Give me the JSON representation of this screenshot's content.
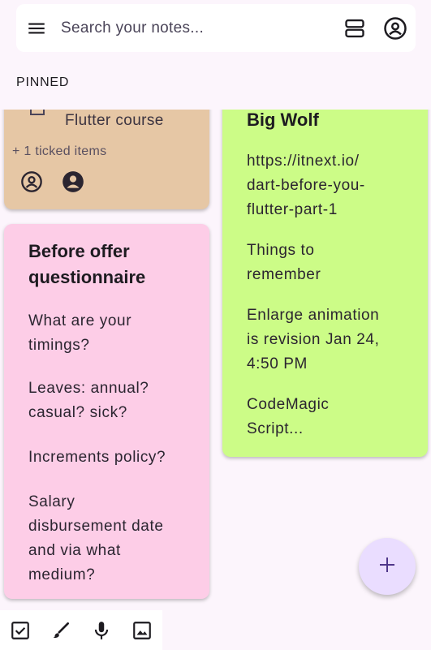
{
  "search": {
    "placeholder": "Search your notes..."
  },
  "section": {
    "pinned_label": "PINNED"
  },
  "notes": {
    "tan": {
      "checklist_item": "Flutter course",
      "ticked_summary": "+ 1 ticked items",
      "color": "#e6c7a5"
    },
    "pink": {
      "title_line1": "Before offer",
      "title_line2": "questionnaire",
      "paragraphs": [
        [
          "What are your",
          "timings?"
        ],
        [
          "Leaves: annual?",
          "casual? sick?"
        ],
        [
          "Increments policy?"
        ],
        [
          "Salary",
          "disbursement date",
          "and via what",
          "medium?"
        ]
      ],
      "color": "#fdcde7"
    },
    "green": {
      "title": "Big Wolf",
      "paragraphs": [
        [
          "https://itnext.io/",
          "dart-before-you-",
          "flutter-part-1"
        ],
        [
          "Things to",
          "remember"
        ],
        [
          "Enlarge animation",
          "is revision Jan 24,",
          "4:50 PM"
        ],
        [
          "CodeMagic",
          "Script..."
        ]
      ],
      "color": "#ccfc87"
    }
  },
  "icons": {
    "menu": "menu-icon",
    "view_toggle": "view-agenda-icon",
    "account": "account-circle-icon",
    "fab": "add-icon",
    "bottom": [
      "checkbox-icon",
      "brush-icon",
      "mic-icon",
      "image-icon"
    ]
  },
  "colors": {
    "accent": "#eaddff",
    "background": "#fcf5fc"
  }
}
